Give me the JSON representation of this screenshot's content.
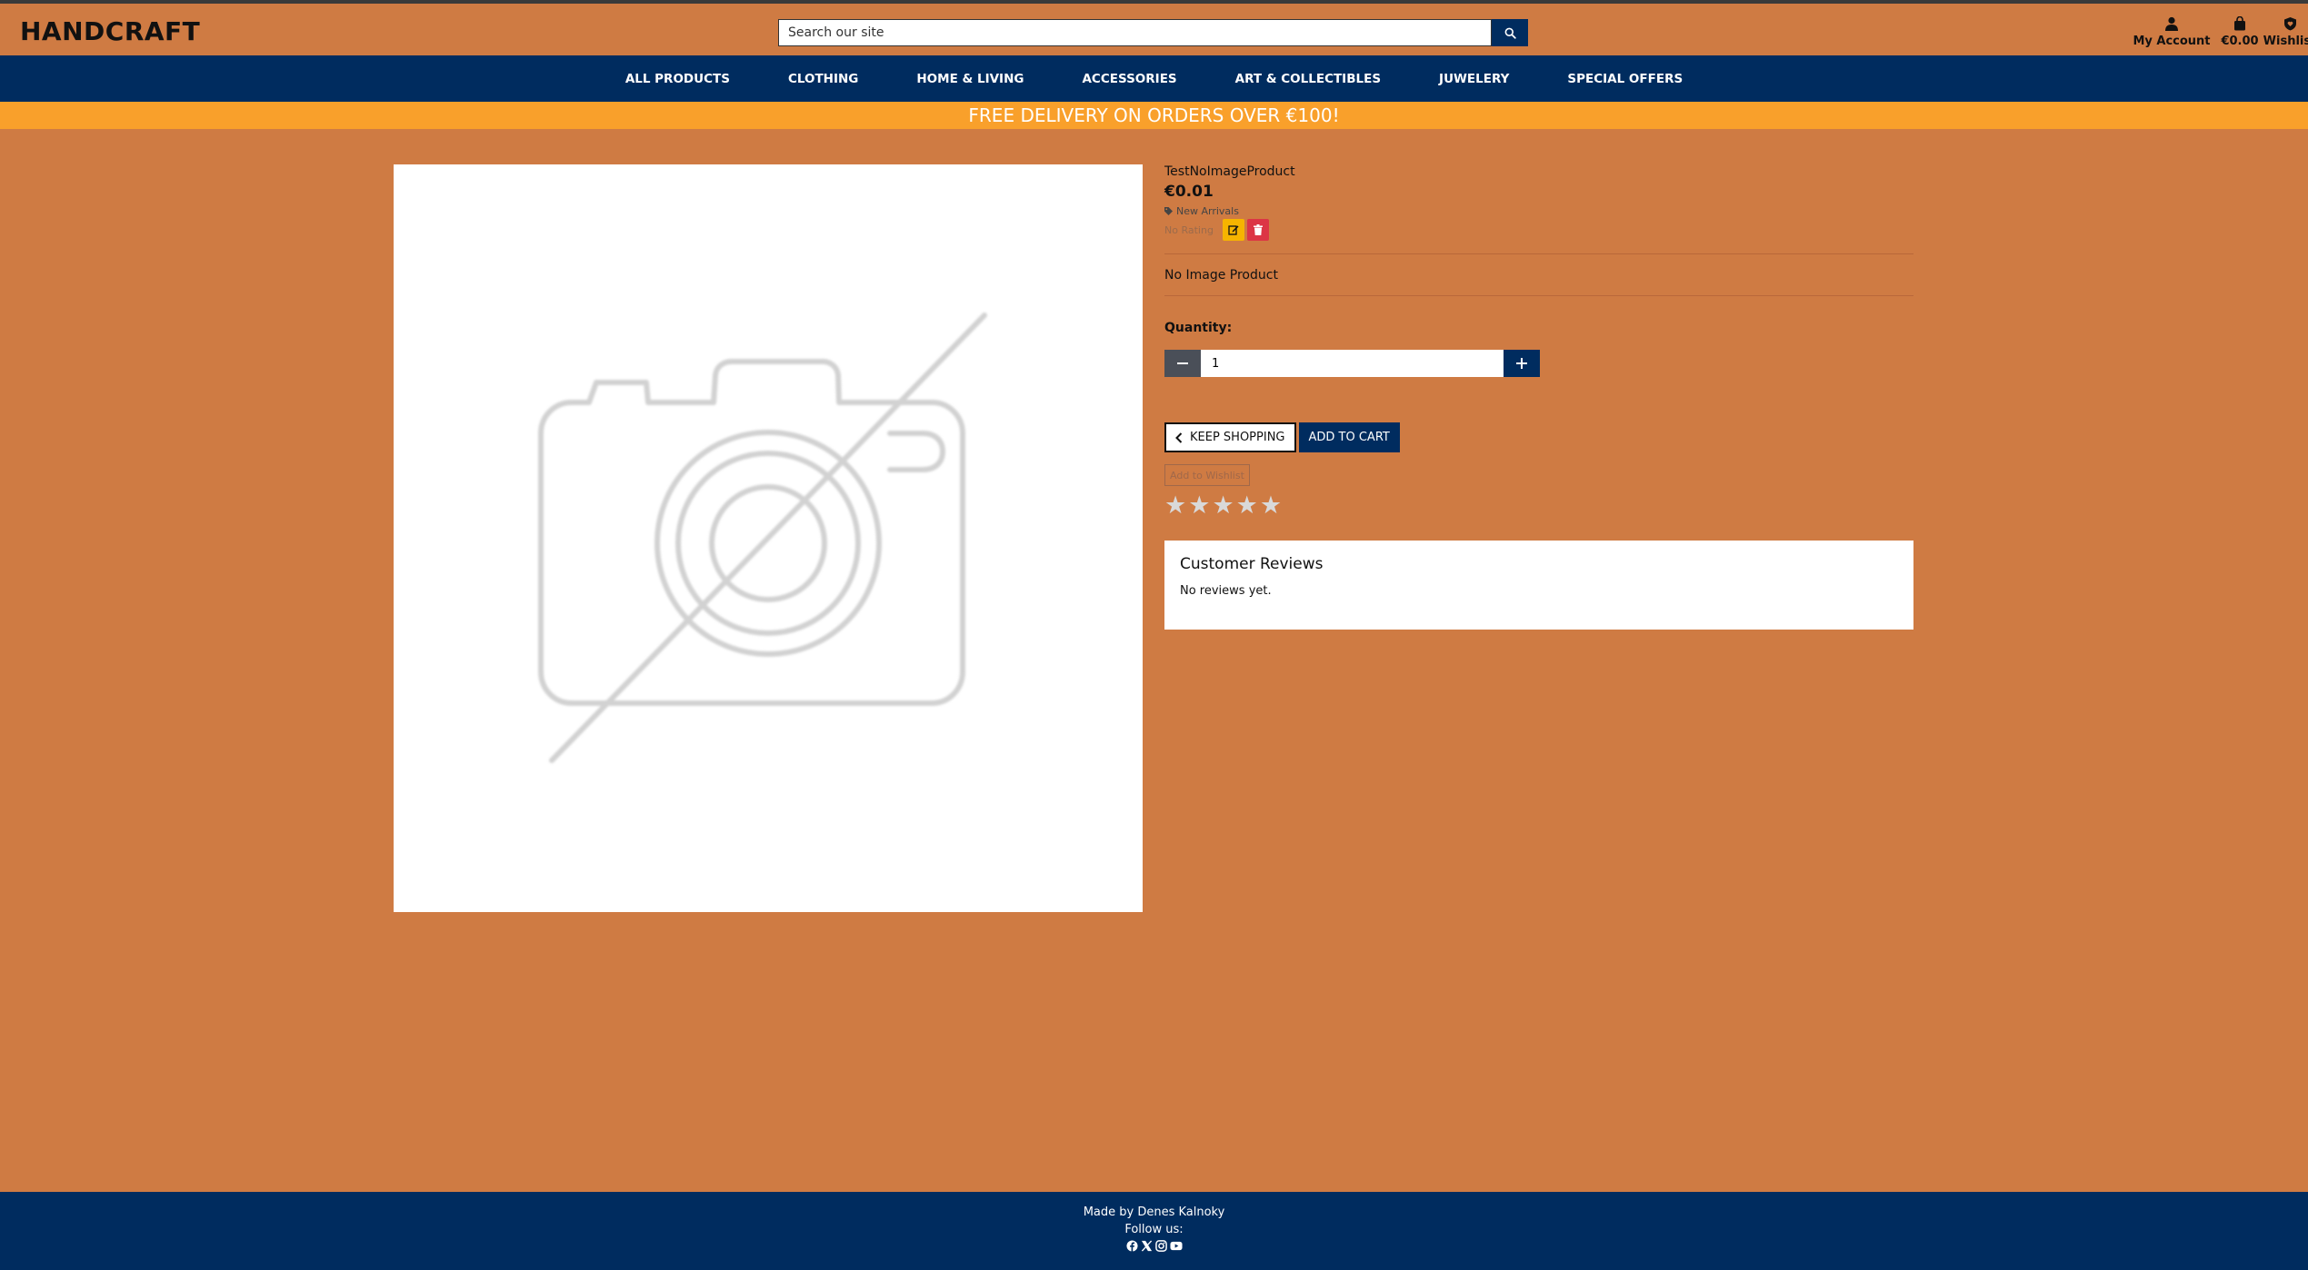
{
  "header": {
    "brand": "HANDCRAFT",
    "search_placeholder": "Search our site",
    "account_label": "My Account",
    "bag_total": "€0.00",
    "wishlist_label": "Wishlist"
  },
  "nav": {
    "items": [
      {
        "label": "ALL PRODUCTS"
      },
      {
        "label": "CLOTHING"
      },
      {
        "label": "HOME & LIVING"
      },
      {
        "label": "ACCESSORIES"
      },
      {
        "label": "ART & COLLECTIBLES"
      },
      {
        "label": "JUWELERY"
      },
      {
        "label": "SPECIAL OFFERS"
      }
    ]
  },
  "banner": {
    "text": "FREE DELIVERY ON ORDERS OVER €100!"
  },
  "product": {
    "name": "TestNoImageProduct",
    "price": "€0.01",
    "category": "New Arrivals",
    "rating_text": "No Rating",
    "description": "No Image Product",
    "quantity_label": "Quantity:",
    "quantity_value": "1",
    "keep_shopping_label": "KEEP SHOPPING",
    "add_to_cart_label": "ADD TO CART",
    "add_to_wishlist_label": "Add to Wishlist",
    "stars": [
      "★",
      "★",
      "★",
      "★",
      "★"
    ],
    "image_icon": "no-image-camera-icon"
  },
  "reviews": {
    "title": "Customer Reviews",
    "empty_text": "No reviews yet."
  },
  "footer": {
    "made_by": "Made by Denes Kalnoky",
    "follow": "Follow us:",
    "social_icons": [
      "facebook-icon",
      "x-icon",
      "instagram-icon",
      "youtube-icon"
    ]
  },
  "colors": {
    "background": "#cf7b43",
    "navy": "#002c5f",
    "banner": "#f9a02b",
    "edit": "#f6b400",
    "delete": "#dc3545"
  }
}
